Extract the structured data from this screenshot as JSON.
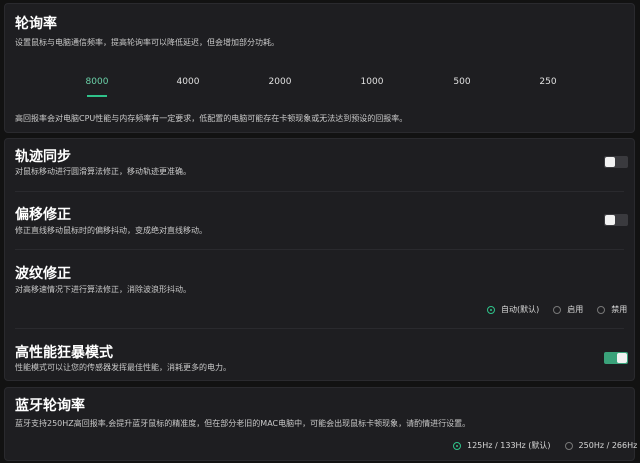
{
  "polling": {
    "title": "轮询率",
    "desc": "设置鼠标与电脑通信频率，提高轮询率可以降低延迟，但会增加部分功耗。",
    "rates": [
      "8000",
      "4000",
      "2000",
      "1000",
      "500",
      "250"
    ],
    "selected": "8000",
    "note": "高回报率会对电脑CPU性能与内存频率有一定要求，低配置的电脑可能存在卡顿现象或无法达到预设的回报率。"
  },
  "motion_sync": {
    "title": "轨迹同步",
    "desc": "对鼠标移动进行圆滑算法修正，移动轨迹更准确。",
    "enabled": false
  },
  "angle_snap": {
    "title": "偏移修正",
    "desc": "修正直线移动鼠标时的偏移抖动，变成绝对直线移动。",
    "enabled": false
  },
  "ripple": {
    "title": "波纹修正",
    "desc": "对高移速情况下进行算法修正，消除波浪形抖动。",
    "options": [
      "自动(默认)",
      "启用",
      "禁用"
    ],
    "selected": "自动(默认)"
  },
  "performance": {
    "title": "高性能狂暴模式",
    "desc": "性能模式可以让您的传感器发挥最佳性能，消耗更多的电力。",
    "enabled": true
  },
  "bluetooth": {
    "title": "蓝牙轮询率",
    "desc": "蓝牙支持250HZ高回报率,会提升蓝牙鼠标的精准度，但在部分老旧的MAC电脑中，可能会出现鼠标卡顿现象，请酌情进行设置。",
    "options": [
      "125Hz / 133Hz (默认)",
      "250Hz / 266Hz"
    ],
    "selected": "125Hz / 133Hz (默认)"
  },
  "colors": {
    "accent": "#2fc28a",
    "toggle_on": "#3aa27a",
    "panel": "#1e1e21",
    "background": "#121212"
  }
}
